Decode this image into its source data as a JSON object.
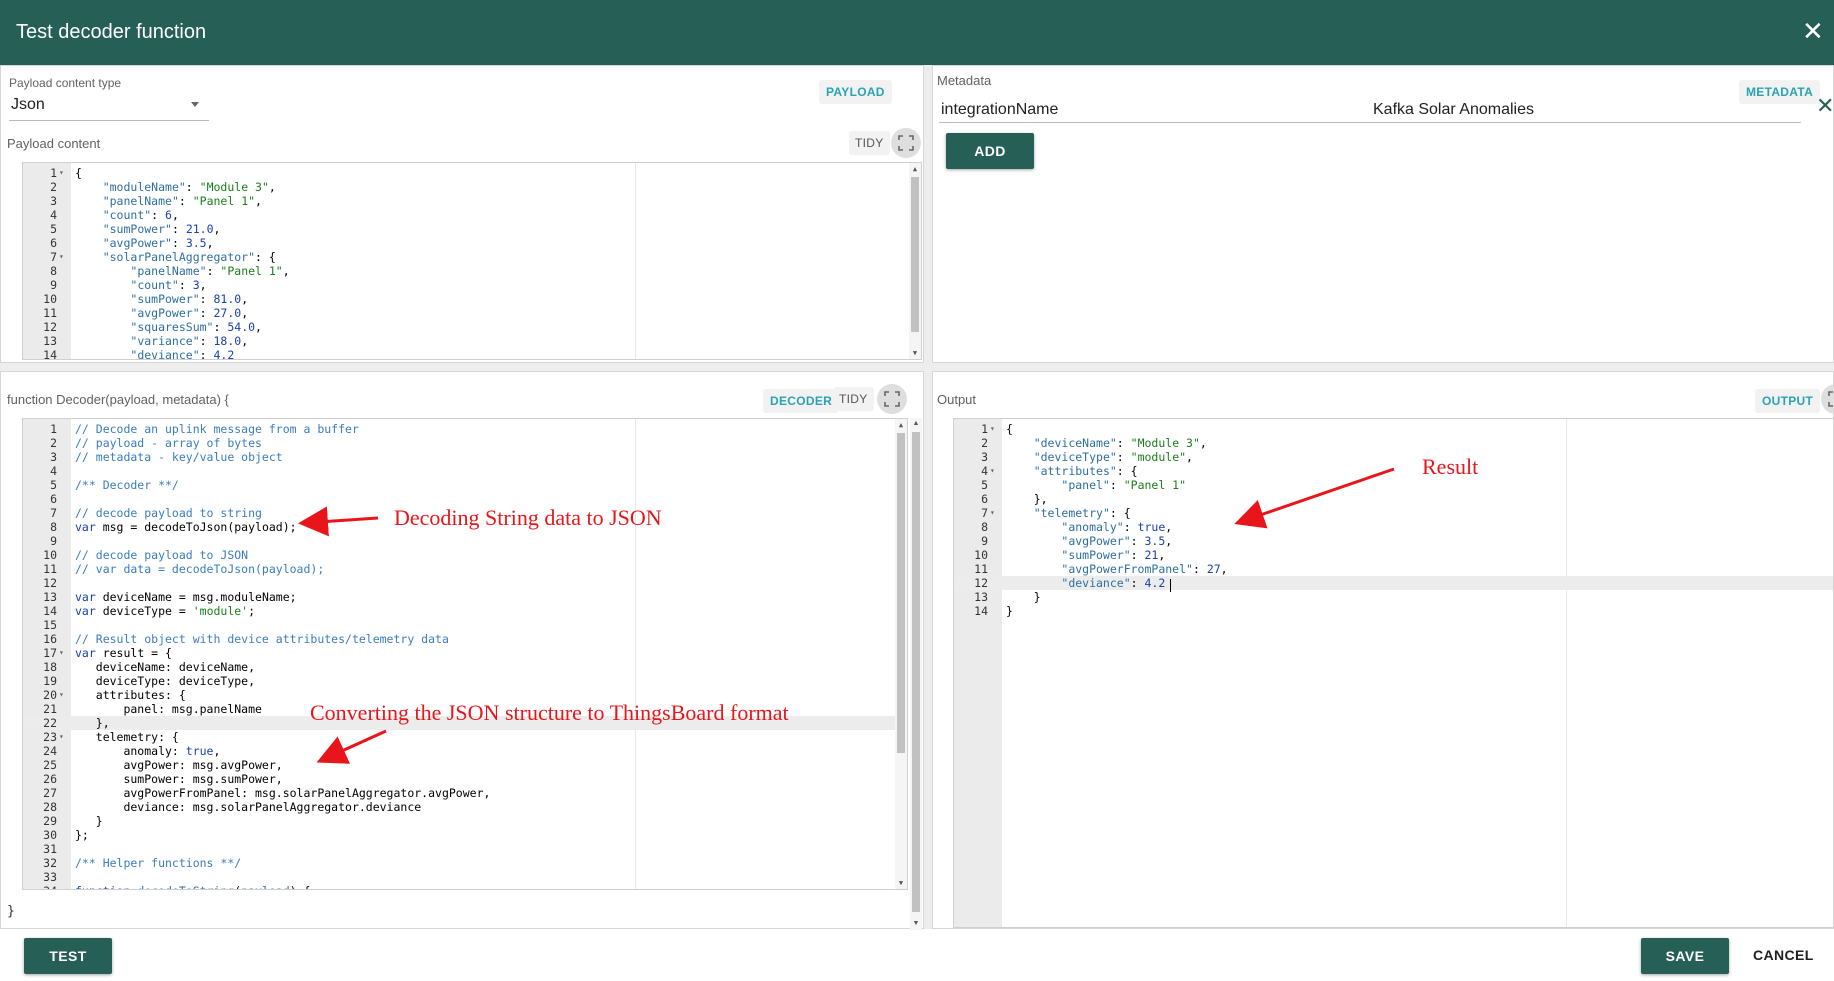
{
  "dialog": {
    "title": "Test decoder function"
  },
  "payload_panel": {
    "content_type_label": "Payload content type",
    "content_type_value": "Json",
    "chip": "PAYLOAD",
    "content_label": "Payload content",
    "tidy": "TIDY",
    "lines": [
      [
        [
          "p",
          "{"
        ]
      ],
      [
        [
          "p",
          "    "
        ],
        [
          "k",
          "\"moduleName\""
        ],
        [
          "p",
          ": "
        ],
        [
          "s",
          "\"Module 3\""
        ],
        [
          "p",
          ","
        ]
      ],
      [
        [
          "p",
          "    "
        ],
        [
          "k",
          "\"panelName\""
        ],
        [
          "p",
          ": "
        ],
        [
          "s",
          "\"Panel 1\""
        ],
        [
          "p",
          ","
        ]
      ],
      [
        [
          "p",
          "    "
        ],
        [
          "k",
          "\"count\""
        ],
        [
          "p",
          ": "
        ],
        [
          "n",
          "6"
        ],
        [
          "p",
          ","
        ]
      ],
      [
        [
          "p",
          "    "
        ],
        [
          "k",
          "\"sumPower\""
        ],
        [
          "p",
          ": "
        ],
        [
          "n",
          "21.0"
        ],
        [
          "p",
          ","
        ]
      ],
      [
        [
          "p",
          "    "
        ],
        [
          "k",
          "\"avgPower\""
        ],
        [
          "p",
          ": "
        ],
        [
          "n",
          "3.5"
        ],
        [
          "p",
          ","
        ]
      ],
      [
        [
          "p",
          "    "
        ],
        [
          "k",
          "\"solarPanelAggregator\""
        ],
        [
          "p",
          ": {"
        ]
      ],
      [
        [
          "p",
          "        "
        ],
        [
          "k",
          "\"panelName\""
        ],
        [
          "p",
          ": "
        ],
        [
          "s",
          "\"Panel 1\""
        ],
        [
          "p",
          ","
        ]
      ],
      [
        [
          "p",
          "        "
        ],
        [
          "k",
          "\"count\""
        ],
        [
          "p",
          ": "
        ],
        [
          "n",
          "3"
        ],
        [
          "p",
          ","
        ]
      ],
      [
        [
          "p",
          "        "
        ],
        [
          "k",
          "\"sumPower\""
        ],
        [
          "p",
          ": "
        ],
        [
          "n",
          "81.0"
        ],
        [
          "p",
          ","
        ]
      ],
      [
        [
          "p",
          "        "
        ],
        [
          "k",
          "\"avgPower\""
        ],
        [
          "p",
          ": "
        ],
        [
          "n",
          "27.0"
        ],
        [
          "p",
          ","
        ]
      ],
      [
        [
          "p",
          "        "
        ],
        [
          "k",
          "\"squaresSum\""
        ],
        [
          "p",
          ": "
        ],
        [
          "n",
          "54.0"
        ],
        [
          "p",
          ","
        ]
      ],
      [
        [
          "p",
          "        "
        ],
        [
          "k",
          "\"variance\""
        ],
        [
          "p",
          ": "
        ],
        [
          "n",
          "18.0"
        ],
        [
          "p",
          ","
        ]
      ],
      [
        [
          "p",
          "        "
        ],
        [
          "k",
          "\"deviance\""
        ],
        [
          "p",
          ": "
        ],
        [
          "n",
          "4.2"
        ]
      ]
    ],
    "fold_lines": [
      1,
      7
    ]
  },
  "metadata_panel": {
    "label": "Metadata",
    "chip": "METADATA",
    "key": "integrationName",
    "value": "Kafka Solar Anomalies",
    "add_button": "ADD"
  },
  "decoder_panel": {
    "signature": "function Decoder(payload, metadata) {",
    "closing": "}",
    "chip": "DECODER",
    "tidy": "TIDY",
    "active_line": 22,
    "fold_lines": [
      17,
      20,
      23,
      34
    ],
    "lines": [
      [
        [
          "c",
          "// Decode an uplink message from a buffer"
        ]
      ],
      [
        [
          "c",
          "// payload - array of bytes"
        ]
      ],
      [
        [
          "c",
          "// metadata - key/value object"
        ]
      ],
      [],
      [
        [
          "c",
          "/** Decoder **/"
        ]
      ],
      [],
      [
        [
          "c",
          "// decode payload to string"
        ]
      ],
      [
        [
          "w",
          "var"
        ],
        [
          "p",
          " msg = decodeToJson(payload);"
        ]
      ],
      [],
      [
        [
          "c",
          "// decode payload to JSON"
        ]
      ],
      [
        [
          "c",
          "// var data = decodeToJson(payload);"
        ]
      ],
      [],
      [
        [
          "w",
          "var"
        ],
        [
          "p",
          " deviceName = msg.moduleName;"
        ]
      ],
      [
        [
          "w",
          "var"
        ],
        [
          "p",
          " deviceType = "
        ],
        [
          "s",
          "'module'"
        ],
        [
          "p",
          ";"
        ]
      ],
      [],
      [
        [
          "c",
          "// Result object with device attributes/telemetry data"
        ]
      ],
      [
        [
          "w",
          "var"
        ],
        [
          "p",
          " result = {"
        ]
      ],
      [
        [
          "p",
          "   deviceName: deviceName,"
        ]
      ],
      [
        [
          "p",
          "   deviceType: deviceType,"
        ]
      ],
      [
        [
          "p",
          "   attributes: {"
        ]
      ],
      [
        [
          "p",
          "       panel: msg.panelName"
        ]
      ],
      [
        [
          "p",
          "   },"
        ]
      ],
      [
        [
          "p",
          "   telemetry: {"
        ]
      ],
      [
        [
          "p",
          "       anomaly: "
        ],
        [
          "w",
          "true"
        ],
        [
          "p",
          ","
        ]
      ],
      [
        [
          "p",
          "       avgPower: msg.avgPower,"
        ]
      ],
      [
        [
          "p",
          "       sumPower: msg.sumPower,"
        ]
      ],
      [
        [
          "p",
          "       avgPowerFromPanel: msg.solarPanelAggregator.avgPower,"
        ]
      ],
      [
        [
          "p",
          "       deviance: msg.solarPanelAggregator.deviance"
        ]
      ],
      [
        [
          "p",
          "   }"
        ]
      ],
      [
        [
          "p",
          "};"
        ]
      ],
      [],
      [
        [
          "c",
          "/** Helper functions **/"
        ]
      ],
      [],
      [
        [
          "w",
          "function"
        ],
        [
          "p",
          " "
        ],
        [
          "k",
          "decodeToString"
        ],
        [
          "p",
          "("
        ],
        [
          "k",
          "payload"
        ],
        [
          "p",
          ") {"
        ]
      ]
    ]
  },
  "output_panel": {
    "label": "Output",
    "chip": "OUTPUT",
    "active_line": 12,
    "fold_lines": [
      1,
      4,
      7
    ],
    "lines": [
      [
        [
          "p",
          "{"
        ]
      ],
      [
        [
          "p",
          "    "
        ],
        [
          "k",
          "\"deviceName\""
        ],
        [
          "p",
          ": "
        ],
        [
          "s",
          "\"Module 3\""
        ],
        [
          "p",
          ","
        ]
      ],
      [
        [
          "p",
          "    "
        ],
        [
          "k",
          "\"deviceType\""
        ],
        [
          "p",
          ": "
        ],
        [
          "s",
          "\"module\""
        ],
        [
          "p",
          ","
        ]
      ],
      [
        [
          "p",
          "    "
        ],
        [
          "k",
          "\"attributes\""
        ],
        [
          "p",
          ": {"
        ]
      ],
      [
        [
          "p",
          "        "
        ],
        [
          "k",
          "\"panel\""
        ],
        [
          "p",
          ": "
        ],
        [
          "s",
          "\"Panel 1\""
        ]
      ],
      [
        [
          "p",
          "    },"
        ]
      ],
      [
        [
          "p",
          "    "
        ],
        [
          "k",
          "\"telemetry\""
        ],
        [
          "p",
          ": {"
        ]
      ],
      [
        [
          "p",
          "        "
        ],
        [
          "k",
          "\"anomaly\""
        ],
        [
          "p",
          ": "
        ],
        [
          "n",
          "true"
        ],
        [
          "p",
          ","
        ]
      ],
      [
        [
          "p",
          "        "
        ],
        [
          "k",
          "\"avgPower\""
        ],
        [
          "p",
          ": "
        ],
        [
          "n",
          "3.5"
        ],
        [
          "p",
          ","
        ]
      ],
      [
        [
          "p",
          "        "
        ],
        [
          "k",
          "\"sumPower\""
        ],
        [
          "p",
          ": "
        ],
        [
          "n",
          "21"
        ],
        [
          "p",
          ","
        ]
      ],
      [
        [
          "p",
          "        "
        ],
        [
          "k",
          "\"avgPowerFromPanel\""
        ],
        [
          "p",
          ": "
        ],
        [
          "n",
          "27"
        ],
        [
          "p",
          ","
        ]
      ],
      [
        [
          "p",
          "        "
        ],
        [
          "k",
          "\"deviance\""
        ],
        [
          "p",
          ": "
        ],
        [
          "n",
          "4.2"
        ]
      ],
      [
        [
          "p",
          "    }"
        ]
      ],
      [
        [
          "p",
          "}"
        ]
      ]
    ]
  },
  "annotations": {
    "decoding": "Decoding String data to JSON",
    "converting": "Converting the JSON structure to ThingsBoard format",
    "result": "Result"
  },
  "footer": {
    "test": "TEST",
    "save": "SAVE",
    "cancel": "CANCEL"
  },
  "colors": {
    "primary": "#255f56",
    "accent": "#2aa3b4",
    "annotation": "#e8161b"
  }
}
